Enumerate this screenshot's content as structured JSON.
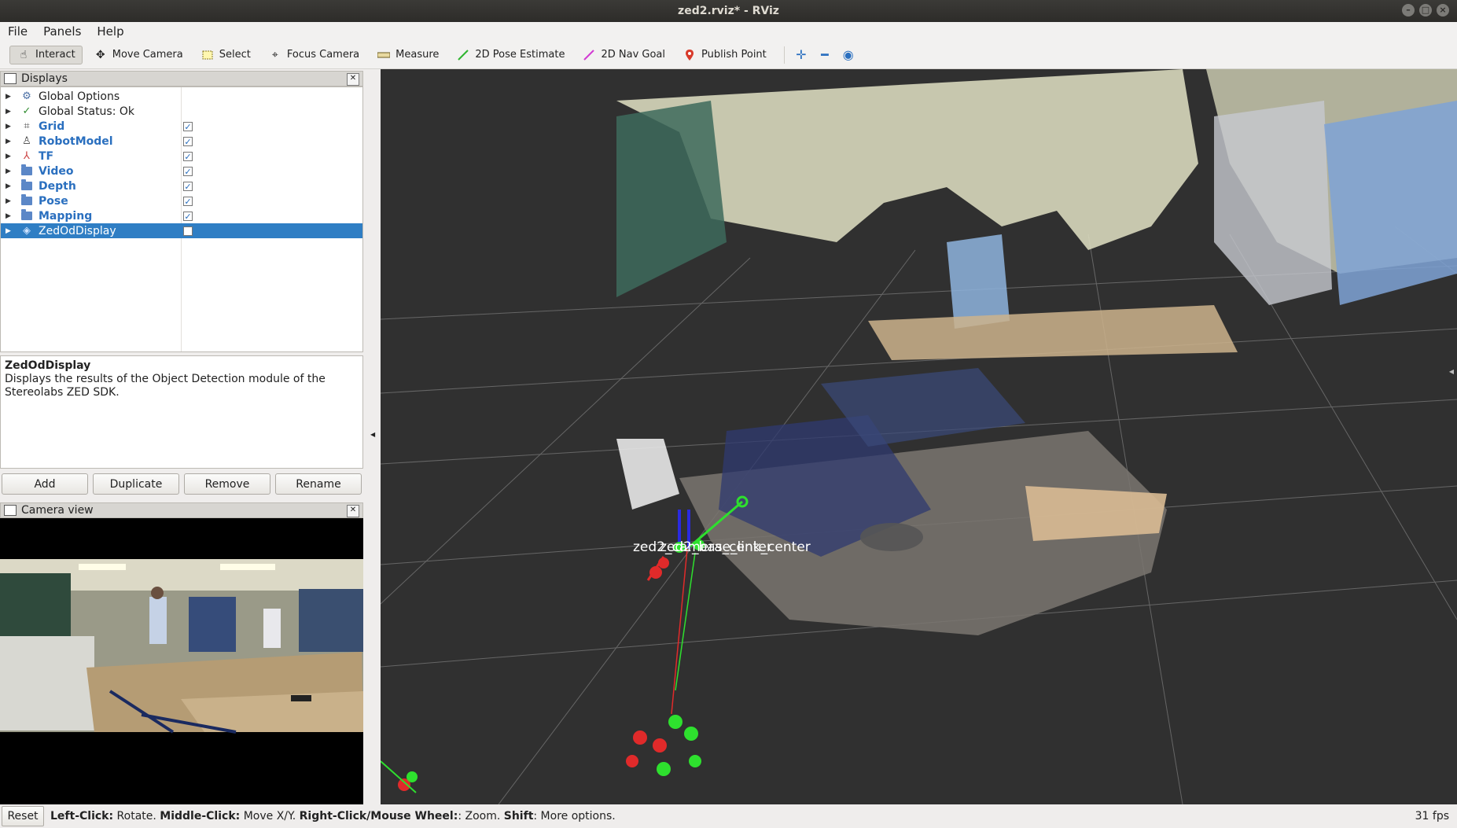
{
  "window": {
    "title": "zed2.rviz* - RViz"
  },
  "menu": {
    "file": "File",
    "panels": "Panels",
    "help": "Help"
  },
  "toolbar": {
    "interact": "Interact",
    "move_camera": "Move Camera",
    "select": "Select",
    "focus_camera": "Focus Camera",
    "measure": "Measure",
    "pose_estimate": "2D Pose Estimate",
    "nav_goal": "2D Nav Goal",
    "publish_point": "Publish Point"
  },
  "displays": {
    "title": "Displays",
    "items": [
      {
        "label": "Global Options",
        "icon": "gear-icon"
      },
      {
        "label": "Global Status: Ok",
        "icon": "check-icon"
      },
      {
        "label": "Grid",
        "icon": "grid-icon",
        "checked": true
      },
      {
        "label": "RobotModel",
        "icon": "robot-icon",
        "checked": true
      },
      {
        "label": "TF",
        "icon": "axes-icon",
        "checked": true
      },
      {
        "label": "Video",
        "icon": "folder-icon",
        "checked": true
      },
      {
        "label": "Depth",
        "icon": "folder-icon",
        "checked": true
      },
      {
        "label": "Pose",
        "icon": "folder-icon",
        "checked": true
      },
      {
        "label": "Mapping",
        "icon": "folder-icon",
        "checked": true
      },
      {
        "label": "ZedOdDisplay",
        "icon": "plugin-icon",
        "checked": false,
        "selected": true
      }
    ],
    "description_title": "ZedOdDisplay",
    "description_text": "Displays the results of the Object Detection module of the Stereolabs ZED SDK.",
    "buttons": {
      "add": "Add",
      "duplicate": "Duplicate",
      "remove": "Remove",
      "rename": "Rename"
    }
  },
  "camera_view": {
    "title": "Camera view"
  },
  "viewport": {
    "frame_label": "zed2_base_link_center",
    "frame_label_overlap": "zed2_camera_center"
  },
  "status": {
    "reset": "Reset",
    "left_click": "Left-Click:",
    "left_click_action": " Rotate. ",
    "middle_click": "Middle-Click:",
    "middle_click_action": " Move X/Y. ",
    "right_click": "Right-Click/Mouse Wheel:",
    "right_click_action": ": Zoom. ",
    "shift": "Shift",
    "shift_action": ": More options.",
    "fps": "31 fps"
  },
  "colors": {
    "selection": "#2f7ec4",
    "viewport_bg": "#303030",
    "checked_label": "#2a6fbf"
  }
}
